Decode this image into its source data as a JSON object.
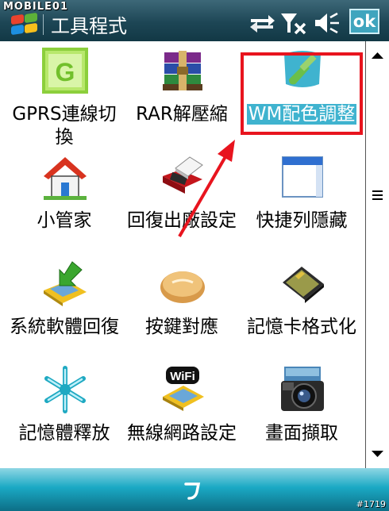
{
  "watermark": "MOBILE01",
  "title": "工具程式",
  "ok_label": "ok",
  "accent": "#3fb3cf",
  "annotation_color": "#e8141e",
  "items": [
    {
      "label": "GPRS連線切換",
      "icon": "gprs-g-icon"
    },
    {
      "label": "RAR解壓縮",
      "icon": "rar-archive-icon"
    },
    {
      "label": "WM配色調整",
      "icon": "paint-brush-icon",
      "selected": true
    },
    {
      "label": "小管家",
      "icon": "house-icon"
    },
    {
      "label": "回復出廠設定",
      "icon": "eraser-device-icon"
    },
    {
      "label": "快捷列隱藏",
      "icon": "window-icon"
    },
    {
      "label": "系統軟體回復",
      "icon": "install-arrow-icon"
    },
    {
      "label": "按鍵對應",
      "icon": "bread-key-icon"
    },
    {
      "label": "記憶卡格式化",
      "icon": "memory-card-icon"
    },
    {
      "label": "記憶體釋放",
      "icon": "snowflake-icon"
    },
    {
      "label": "無線網路設定",
      "icon": "wifi-icon"
    },
    {
      "label": "畫面擷取",
      "icon": "camera-icon"
    }
  ],
  "image_id": "#1719"
}
